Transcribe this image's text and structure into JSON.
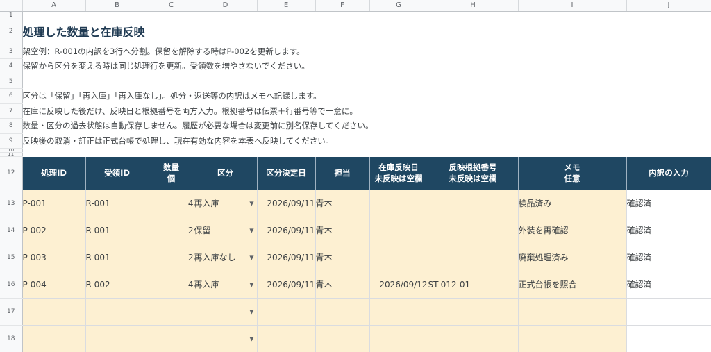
{
  "columns": [
    "A",
    "B",
    "C",
    "D",
    "E",
    "F",
    "G",
    "H",
    "I",
    "J"
  ],
  "row_numbers": [
    "1",
    "2",
    "3",
    "4",
    "5",
    "6",
    "7",
    "8",
    "9",
    "10",
    "11",
    "12",
    "13",
    "14",
    "15",
    "16",
    "17",
    "18"
  ],
  "title": "処理した数量と在庫反映",
  "notes": [
    "架空例：R-001の内訳を3行へ分割。保留を解除する時はP-002を更新します。",
    "保留から区分を変える時は同じ処理行を更新。受領数を増やさないでください。",
    "",
    "区分は「保留」「再入庫」「再入庫なし」。処分・返送等の内訳はメモへ記録します。",
    "在庫に反映した後だけ、反映日と根拠番号を両方入力。根拠番号は伝票＋行番号等で一意に。",
    "数量・区分の過去状態は自動保存しません。履歴が必要な場合は変更前に別名保存してください。",
    "反映後の取消・訂正は正式台帳で処理し、現在有効な内容を本表へ反映してください。"
  ],
  "headers": {
    "process_id": "処理ID",
    "receipt_id": "受領ID",
    "qty_line1": "数量",
    "qty_line2": "個",
    "category": "区分",
    "decided_date": "区分決定日",
    "owner": "担当",
    "stock_date_line1": "在庫反映日",
    "stock_date_line2": "未反映は空欄",
    "ref_no_line1": "反映根拠番号",
    "ref_no_line2": "未反映は空欄",
    "memo_line1": "メモ",
    "memo_line2": "任意",
    "breakdown": "内訳の入力"
  },
  "rows": [
    {
      "process_id": "P-001",
      "receipt_id": "R-001",
      "qty": "4",
      "category": "再入庫",
      "decided_date": "2026/09/11",
      "owner": "青木",
      "stock_date": "",
      "ref_no": "",
      "memo": "検品済み",
      "breakdown": "確認済"
    },
    {
      "process_id": "P-002",
      "receipt_id": "R-001",
      "qty": "2",
      "category": "保留",
      "decided_date": "2026/09/11",
      "owner": "青木",
      "stock_date": "",
      "ref_no": "",
      "memo": "外装を再確認",
      "breakdown": "確認済"
    },
    {
      "process_id": "P-003",
      "receipt_id": "R-001",
      "qty": "2",
      "category": "再入庫なし",
      "decided_date": "2026/09/11",
      "owner": "青木",
      "stock_date": "",
      "ref_no": "",
      "memo": "廃棄処理済み",
      "breakdown": "確認済"
    },
    {
      "process_id": "P-004",
      "receipt_id": "R-002",
      "qty": "4",
      "category": "再入庫",
      "decided_date": "2026/09/11",
      "owner": "青木",
      "stock_date": "2026/09/12",
      "ref_no": "ST-012-01",
      "memo": "正式台帳を照合",
      "breakdown": "確認済"
    },
    {
      "process_id": "",
      "receipt_id": "",
      "qty": "",
      "category": "",
      "decided_date": "",
      "owner": "",
      "stock_date": "",
      "ref_no": "",
      "memo": "",
      "breakdown": ""
    },
    {
      "process_id": "",
      "receipt_id": "",
      "qty": "",
      "category": "",
      "decided_date": "",
      "owner": "",
      "stock_date": "",
      "ref_no": "",
      "memo": "",
      "breakdown": ""
    }
  ],
  "icons": {
    "dropdown": "dropdown-arrow-icon"
  },
  "colors": {
    "header_bg": "#1f4762",
    "input_bg": "#fdf0d2",
    "title": "#1f3a52"
  }
}
